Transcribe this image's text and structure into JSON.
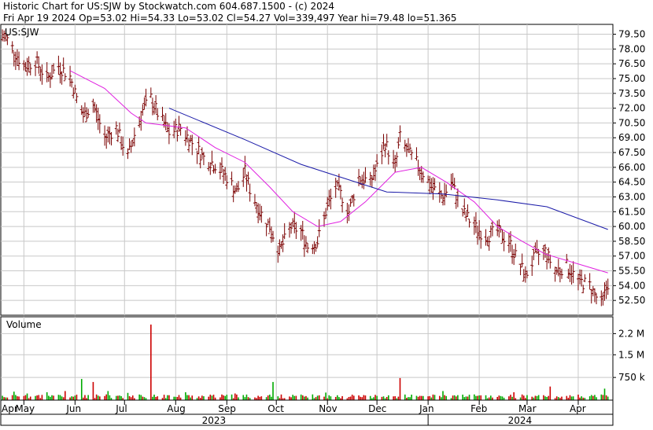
{
  "header": {
    "line1": "Historic Chart for US:SJW by Stockwatch.com 604.687.1500 - (c) 2024",
    "line2": "Fri Apr 19 2024   Op=53.02  Hi=54.33  Lo=53.02  Cl=54.27  Vol=339,497   Year hi=79.48  lo=51.365"
  },
  "chart_data": [
    {
      "type": "line",
      "series_label": "US:SJW",
      "y_ticks": [
        "79.50",
        "78.00",
        "76.50",
        "75.00",
        "73.50",
        "72.00",
        "70.50",
        "69.00",
        "67.50",
        "66.00",
        "64.50",
        "63.00",
        "61.50",
        "60.00",
        "58.50",
        "57.00",
        "55.50",
        "54.00",
        "52.50"
      ],
      "ylim": [
        51.0,
        80.5
      ],
      "x_ticks": [
        "Apr",
        "May",
        "Jun",
        "Jul",
        "Aug",
        "Sep",
        "Oct",
        "Nov",
        "Dec",
        "Jan",
        "Feb",
        "Mar",
        "Apr"
      ],
      "x_years": [
        "2023",
        "2024"
      ],
      "grid": true,
      "colors": {
        "bars": "#7a0000",
        "sma20": "#e020e0",
        "sma200": "#1a1aa8",
        "grid": "#c8c8c8"
      },
      "price_points": [
        {
          "x": "2023-04-20",
          "y": 79.2
        },
        {
          "x": "2023-05-01",
          "y": 76.2
        },
        {
          "x": "2023-05-08",
          "y": 76.8
        },
        {
          "x": "2023-05-15",
          "y": 75.0
        },
        {
          "x": "2023-05-22",
          "y": 76.3
        },
        {
          "x": "2023-05-29",
          "y": 75.2
        },
        {
          "x": "2023-06-02",
          "y": 73.0
        },
        {
          "x": "2023-06-06",
          "y": 71.2
        },
        {
          "x": "2023-06-12",
          "y": 72.4
        },
        {
          "x": "2023-06-19",
          "y": 69.0
        },
        {
          "x": "2023-06-26",
          "y": 70.0
        },
        {
          "x": "2023-07-03",
          "y": 67.0
        },
        {
          "x": "2023-07-07",
          "y": 69.3
        },
        {
          "x": "2023-07-12",
          "y": 71.8
        },
        {
          "x": "2023-07-17",
          "y": 73.0
        },
        {
          "x": "2023-07-21",
          "y": 71.5
        },
        {
          "x": "2023-07-28",
          "y": 69.5
        },
        {
          "x": "2023-08-04",
          "y": 70.0
        },
        {
          "x": "2023-08-11",
          "y": 68.5
        },
        {
          "x": "2023-08-18",
          "y": 67.0
        },
        {
          "x": "2023-08-25",
          "y": 66.3
        },
        {
          "x": "2023-09-01",
          "y": 65.0
        },
        {
          "x": "2023-09-07",
          "y": 63.5
        },
        {
          "x": "2023-09-12",
          "y": 65.5
        },
        {
          "x": "2023-09-15",
          "y": 63.8
        },
        {
          "x": "2023-09-21",
          "y": 61.5
        },
        {
          "x": "2023-09-27",
          "y": 60.0
        },
        {
          "x": "2023-10-03",
          "y": 57.5
        },
        {
          "x": "2023-10-10",
          "y": 60.0
        },
        {
          "x": "2023-10-16",
          "y": 59.5
        },
        {
          "x": "2023-10-20",
          "y": 58.0
        },
        {
          "x": "2023-10-26",
          "y": 58.5
        },
        {
          "x": "2023-10-31",
          "y": 61.5
        },
        {
          "x": "2023-11-06",
          "y": 64.0
        },
        {
          "x": "2023-11-10",
          "y": 63.0
        },
        {
          "x": "2023-11-14",
          "y": 61.5
        },
        {
          "x": "2023-11-20",
          "y": 65.0
        },
        {
          "x": "2023-11-27",
          "y": 64.5
        },
        {
          "x": "2023-12-01",
          "y": 66.0
        },
        {
          "x": "2023-12-06",
          "y": 68.5
        },
        {
          "x": "2023-12-12",
          "y": 66.0
        },
        {
          "x": "2023-12-15",
          "y": 69.0
        },
        {
          "x": "2023-12-20",
          "y": 67.5
        },
        {
          "x": "2023-12-27",
          "y": 66.0
        },
        {
          "x": "2024-01-03",
          "y": 64.0
        },
        {
          "x": "2024-01-10",
          "y": 63.0
        },
        {
          "x": "2024-01-15",
          "y": 64.5
        },
        {
          "x": "2024-01-22",
          "y": 61.5
        },
        {
          "x": "2024-01-29",
          "y": 60.0
        },
        {
          "x": "2024-02-05",
          "y": 59.0
        },
        {
          "x": "2024-02-12",
          "y": 59.5
        },
        {
          "x": "2024-02-19",
          "y": 58.5
        },
        {
          "x": "2024-02-23",
          "y": 57.0
        },
        {
          "x": "2024-02-29",
          "y": 55.0
        },
        {
          "x": "2024-03-06",
          "y": 57.0
        },
        {
          "x": "2024-03-12",
          "y": 57.5
        },
        {
          "x": "2024-03-18",
          "y": 55.5
        },
        {
          "x": "2024-03-25",
          "y": 56.0
        },
        {
          "x": "2024-04-01",
          "y": 54.5
        },
        {
          "x": "2024-04-08",
          "y": 54.0
        },
        {
          "x": "2024-04-15",
          "y": 52.0
        },
        {
          "x": "2024-04-19",
          "y": 54.27
        }
      ],
      "sma20": [
        {
          "x": "2023-05-29",
          "y": 75.8
        },
        {
          "x": "2023-06-19",
          "y": 74.0
        },
        {
          "x": "2023-07-05",
          "y": 71.5
        },
        {
          "x": "2023-07-14",
          "y": 70.5
        },
        {
          "x": "2023-08-07",
          "y": 70.0
        },
        {
          "x": "2023-08-25",
          "y": 68.0
        },
        {
          "x": "2023-09-12",
          "y": 66.5
        },
        {
          "x": "2023-09-27",
          "y": 64.0
        },
        {
          "x": "2023-10-11",
          "y": 61.5
        },
        {
          "x": "2023-10-26",
          "y": 60.0
        },
        {
          "x": "2023-11-09",
          "y": 60.5
        },
        {
          "x": "2023-11-24",
          "y": 62.5
        },
        {
          "x": "2023-12-12",
          "y": 65.5
        },
        {
          "x": "2023-12-28",
          "y": 66.0
        },
        {
          "x": "2024-01-12",
          "y": 64.5
        },
        {
          "x": "2024-01-29",
          "y": 62.5
        },
        {
          "x": "2024-02-12",
          "y": 60.0
        },
        {
          "x": "2024-02-27",
          "y": 58.5
        },
        {
          "x": "2024-03-12",
          "y": 57.2
        },
        {
          "x": "2024-04-19",
          "y": 55.3
        }
      ],
      "sma200": [
        {
          "x": "2023-07-28",
          "y": 72.0
        },
        {
          "x": "2023-09-12",
          "y": 68.8
        },
        {
          "x": "2023-10-16",
          "y": 66.3
        },
        {
          "x": "2023-11-09",
          "y": 65.0
        },
        {
          "x": "2023-12-07",
          "y": 63.5
        },
        {
          "x": "2024-01-10",
          "y": 63.3
        },
        {
          "x": "2024-02-12",
          "y": 62.7
        },
        {
          "x": "2024-03-13",
          "y": 62.0
        },
        {
          "x": "2024-04-19",
          "y": 59.7
        }
      ]
    },
    {
      "type": "bar",
      "title": "Volume",
      "y_ticks": [
        "2.2 M",
        "1.5 M",
        "750 k"
      ],
      "ylim": [
        0,
        2600000
      ],
      "colors": {
        "up": "#00aa00",
        "down": "#cc0000"
      },
      "spikes": [
        {
          "x": "2023-04-25",
          "value": 280000
        },
        {
          "x": "2023-05-03",
          "value": 220000
        },
        {
          "x": "2023-05-15",
          "value": 260000
        },
        {
          "x": "2023-05-26",
          "value": 300000
        },
        {
          "x": "2023-06-05",
          "value": 700000
        },
        {
          "x": "2023-06-12",
          "value": 600000
        },
        {
          "x": "2023-06-21",
          "value": 300000
        },
        {
          "x": "2023-07-03",
          "value": 240000
        },
        {
          "x": "2023-07-17",
          "value": 2500000
        },
        {
          "x": "2023-08-07",
          "value": 260000
        },
        {
          "x": "2023-09-06",
          "value": 220000
        },
        {
          "x": "2023-09-29",
          "value": 600000
        },
        {
          "x": "2023-10-31",
          "value": 250000
        },
        {
          "x": "2023-12-15",
          "value": 730000
        },
        {
          "x": "2024-01-10",
          "value": 300000
        },
        {
          "x": "2024-02-22",
          "value": 260000
        },
        {
          "x": "2024-03-15",
          "value": 450000
        },
        {
          "x": "2024-04-17",
          "value": 380000
        }
      ]
    }
  ]
}
